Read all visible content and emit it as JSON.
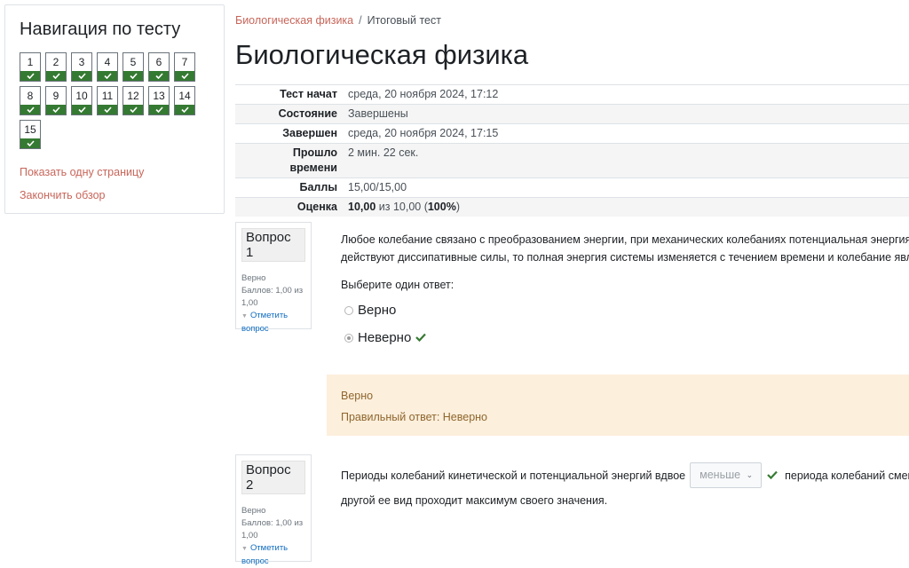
{
  "nav": {
    "title": "Навигация по тесту",
    "questions": [
      "1",
      "2",
      "3",
      "4",
      "5",
      "6",
      "7",
      "8",
      "9",
      "10",
      "11",
      "12",
      "13",
      "14",
      "15"
    ],
    "show_one_page": "Показать одну страницу",
    "finish_review": "Закончить обзор"
  },
  "breadcrumb": {
    "course": "Биологическая физика",
    "separator": "/",
    "current": "Итоговый тест"
  },
  "page_title": "Биологическая физика",
  "summary": [
    {
      "label": "Тест начат",
      "value": "среда, 20 ноября 2024, 17:12"
    },
    {
      "label": "Состояние",
      "value": "Завершены"
    },
    {
      "label": "Завершен",
      "value": "среда, 20 ноября 2024, 17:15"
    },
    {
      "label": "Прошло времени",
      "value": "2 мин. 22 сек."
    },
    {
      "label": "Баллы",
      "value": "15,00/15,00"
    },
    {
      "label": "Оценка",
      "value_bold1": "10,00",
      "value_mid": " из 10,00 (",
      "value_bold2": "100%",
      "value_end": ")"
    }
  ],
  "q1": {
    "number": "Вопрос 1",
    "state": "Верно",
    "marks": "Баллов: 1,00 из 1,00",
    "flag": "Отметить вопрос",
    "text_line1": "Любое колебание связано с преобразованием энергии, при механических колебаниях потенциальная энергия",
    "text_line2": "действуют диссипативные силы, то полная энергия системы изменяется с течением времени и колебание являе",
    "prompt": "Выберите один ответ:",
    "options": [
      "Верно",
      "Неверно"
    ],
    "feedback_state": "Верно",
    "right_answer": "Правильный ответ: Неверно"
  },
  "q2": {
    "number": "Вопрос 2",
    "state": "Верно",
    "marks": "Баллов: 1,00 из 1,00",
    "flag": "Отметить вопрос",
    "text_before": "Периоды колебаний кинетической и потенциальной энергий вдвое",
    "select_value": "меньше",
    "text_after": "периода колебаний смещ",
    "text_line2": "другой ее вид проходит максимум своего значения."
  },
  "colors": {
    "correct": "#357a32",
    "link": "#c8665a",
    "feedback_bg": "#fcefdc"
  }
}
